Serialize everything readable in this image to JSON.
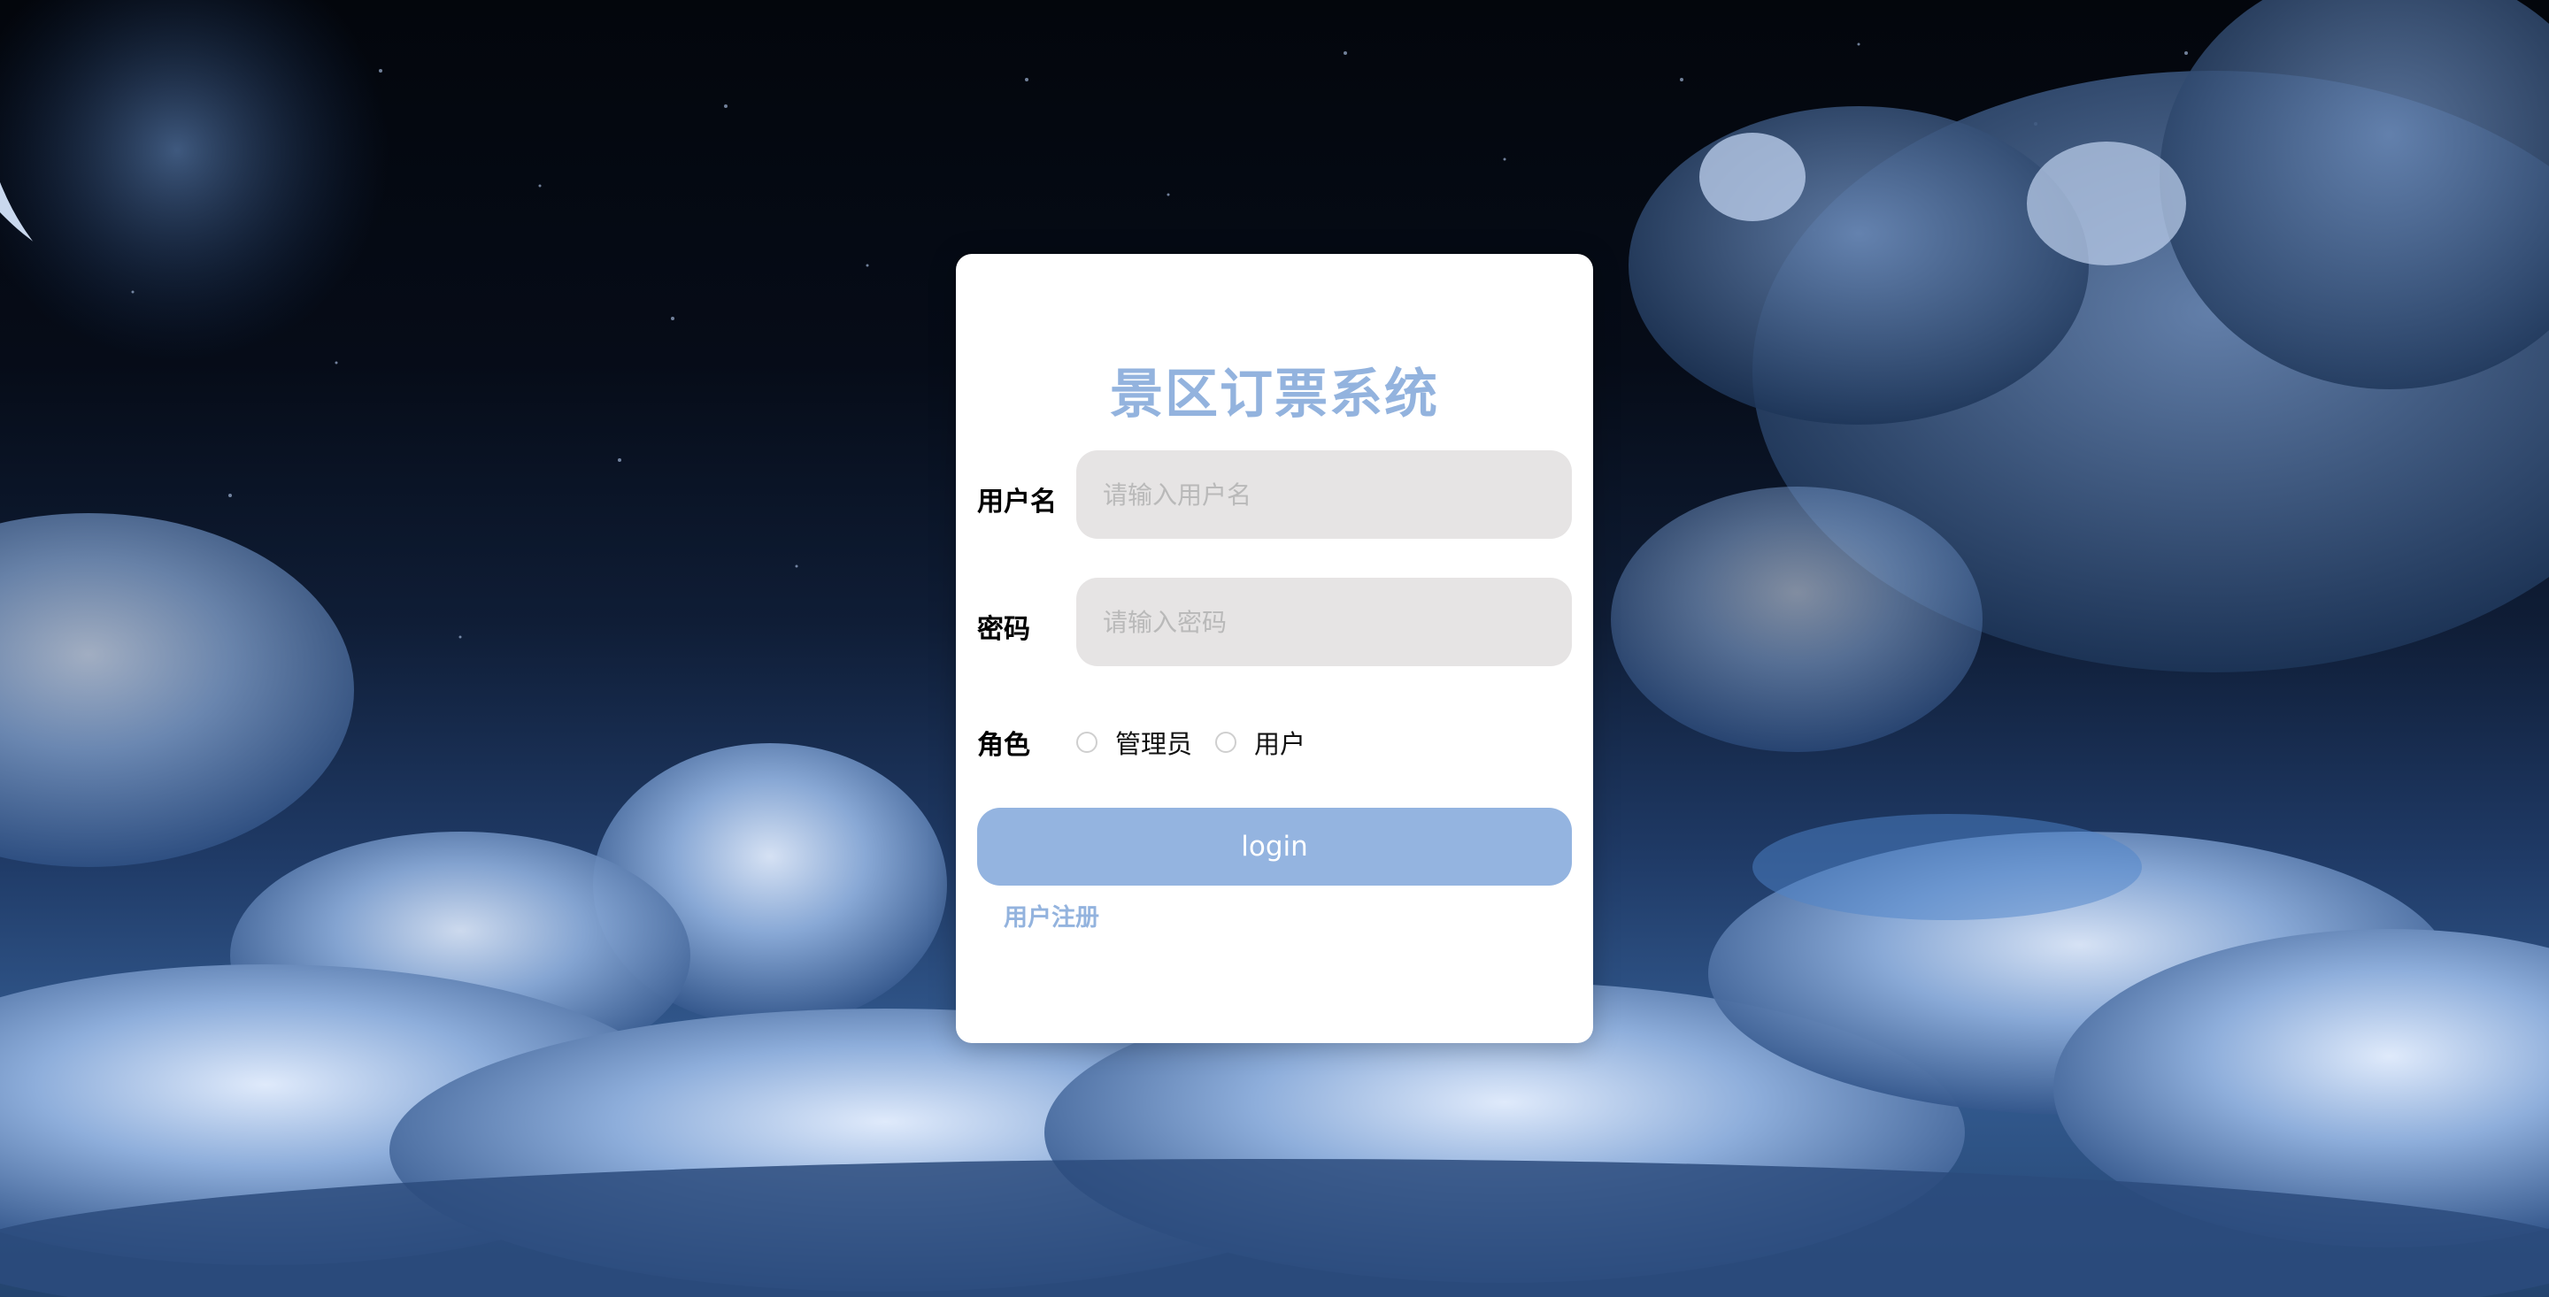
{
  "login": {
    "title": "景区订票系统",
    "username_label": "用户名",
    "username_placeholder": "请输入用户名",
    "password_label": "密码",
    "password_placeholder": "请输入密码",
    "role_label": "角色",
    "role_options": [
      "管理员",
      "用户"
    ],
    "login_button": "login",
    "register_link": "用户注册"
  },
  "colors": {
    "accent": "#94b4e0",
    "title": "#93b3de",
    "input_bg": "#e6e4e4",
    "card_bg": "#ffffff"
  }
}
